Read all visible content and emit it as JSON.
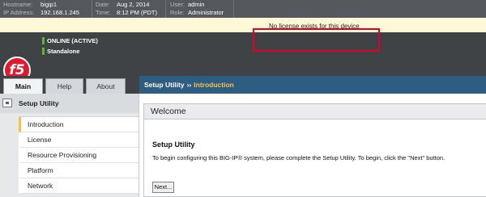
{
  "system_info": {
    "hostname_label": "Hostname:",
    "hostname": "bigip1",
    "ip_label": "IP Address:",
    "ip": "192.168.1.245",
    "date_label": "Date:",
    "date": "Aug 2, 2014",
    "time_label": "Time:",
    "time": "8:12 PM (PDT)",
    "user_label": "User:",
    "user": "admin",
    "role_label": "Role:",
    "role": "Administrator"
  },
  "notice": "No license exists for this device",
  "logo": {
    "text": "f5"
  },
  "status": {
    "line1": "ONLINE (ACTIVE)",
    "line2": "Standalone",
    "indicator_color": "#5bb631"
  },
  "tabs": [
    {
      "label": "Main",
      "active": true
    },
    {
      "label": "Help",
      "active": false
    },
    {
      "label": "About",
      "active": false
    }
  ],
  "breadcrumb": {
    "section": "Setup Utility",
    "separator": "››",
    "current": "Introduction"
  },
  "sidebar": {
    "title": "Setup Utility",
    "items": [
      {
        "label": "Introduction",
        "active": true
      },
      {
        "label": "License",
        "active": false
      },
      {
        "label": "Resource Provisioning",
        "active": false
      },
      {
        "label": "Platform",
        "active": false
      },
      {
        "label": "Network",
        "active": false
      }
    ]
  },
  "content": {
    "header": "Welcome",
    "title": "Setup Utility",
    "text": "To begin configuring this BIG-IP® system, please complete the Setup Utility. To begin, click the \"Next\" button.",
    "next_button": "Next..."
  },
  "colors": {
    "brand_red": "#e2182c",
    "breadcrumb_blue": "#2f5d82",
    "highlight_yellow": "#f4c24a",
    "notice_border": "#e0002a"
  }
}
